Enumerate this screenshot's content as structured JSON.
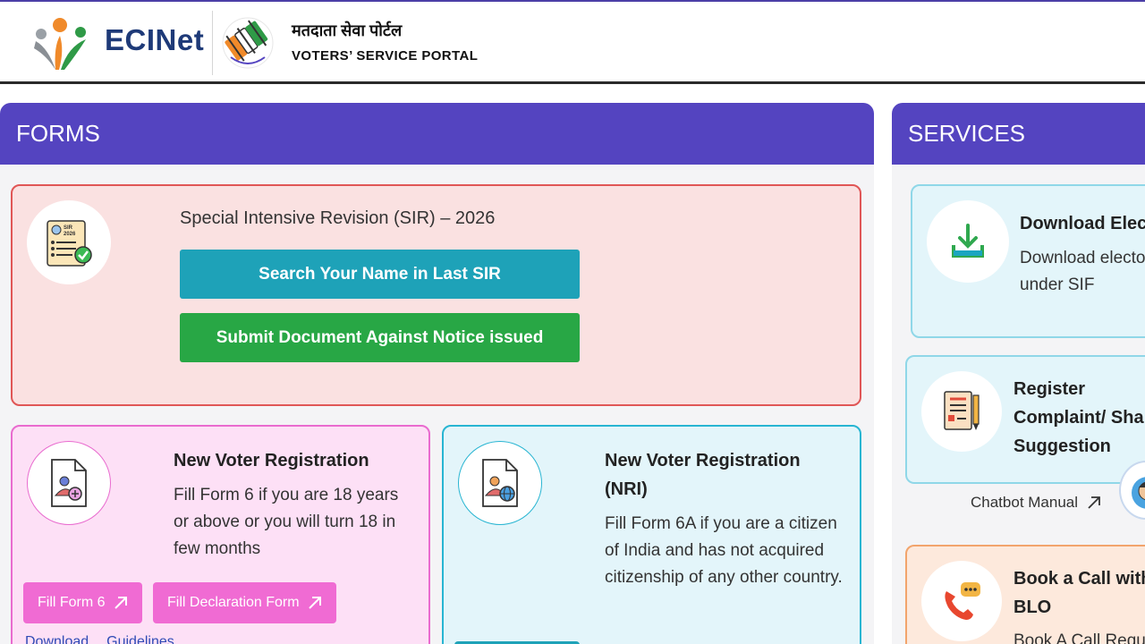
{
  "header": {
    "brand": "ECINet",
    "portal_hindi": "मतदाता सेवा पोर्टल",
    "portal_english": "VOTERS’ SERVICE PORTAL"
  },
  "forms": {
    "heading": "FORMS",
    "sir": {
      "title": "Special Intensive Revision (SIR) – 2026",
      "search_btn": "Search Your Name in Last SIR",
      "submit_btn": "Submit Document Against Notice issued",
      "icon_text": "SIR 2026"
    },
    "new_voter": {
      "title": "New Voter Registration",
      "desc": "Fill Form 6 if you are 18 years or above or you will turn 18 in few months",
      "btn1": "Fill Form 6",
      "btn2": "Fill Declaration Form",
      "link1": "Download",
      "link2": "Guidelines"
    },
    "nri": {
      "title": "New Voter Registration (NRI)",
      "desc": "Fill Form 6A if you are a citizen of India and has not acquired citizenship of any other country."
    }
  },
  "services": {
    "heading": "SERVICES",
    "items": [
      {
        "title": "Download Elec",
        "desc": "Download electo states under SIF"
      },
      {
        "title": "Register Complaint/ Sha Suggestion"
      },
      {
        "title": "Book a Call with BLO",
        "desc": "Book A Call Requ"
      }
    ],
    "chatbot_label": "Chatbot Manual"
  },
  "colors": {
    "header_purple": "#5444c0",
    "teal_button": "#1ea2b8",
    "green_button": "#28a745",
    "pink_button": "#f06bd3",
    "brand_blue": "#1e3a78"
  }
}
